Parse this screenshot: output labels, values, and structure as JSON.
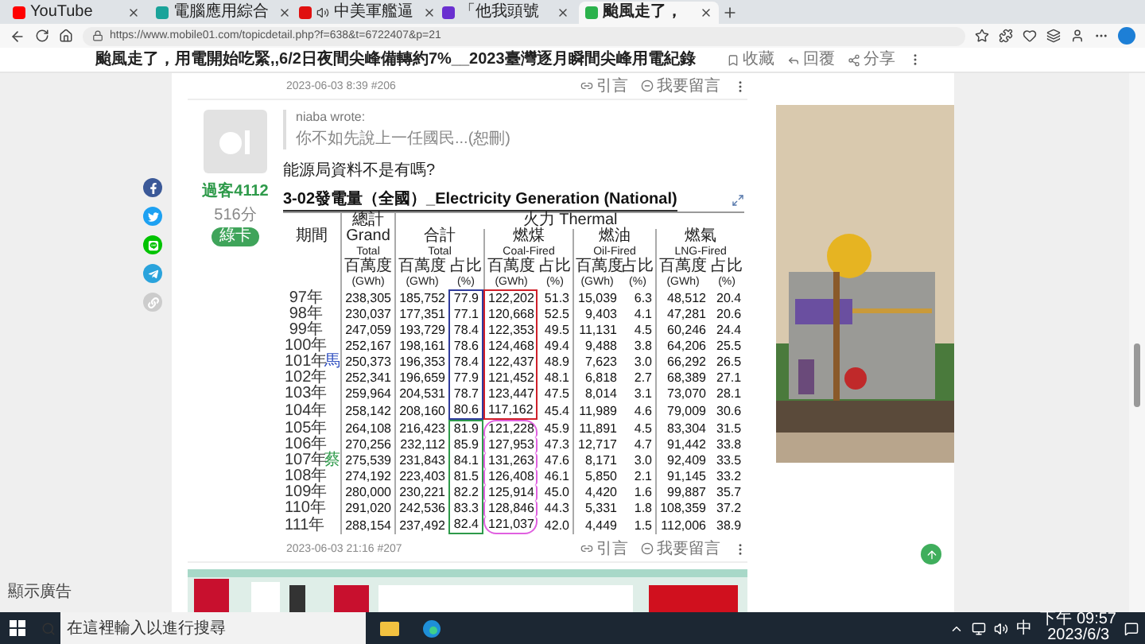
{
  "browser": {
    "tabs": [
      {
        "title": "YouTube",
        "color": "#ff0000",
        "audio": false,
        "selected": false
      },
      {
        "title": "電腦應用綜合",
        "color": "#1aa39a",
        "audio": false,
        "selected": false
      },
      {
        "title": "中美軍艦逼",
        "color": "#e01010",
        "audio": true,
        "selected": false
      },
      {
        "title": "「他我頭號",
        "color": "#6a2fd0",
        "audio": false,
        "selected": false
      },
      {
        "title": "颱風走了，",
        "color": "#2bb24c",
        "audio": false,
        "selected": true
      }
    ],
    "url": "https://www.mobile01.com/topicdetail.php?f=638&t=6722407&p=21"
  },
  "page": {
    "title": "颱風走了，用電開始吃緊,,6/2日夜間尖峰備轉約7%__2023臺灣逐月瞬間尖峰用電紀錄",
    "actions": [
      {
        "kind": "bookmark",
        "label": "收藏"
      },
      {
        "kind": "reply",
        "label": "回覆"
      },
      {
        "kind": "share",
        "label": "分享"
      }
    ]
  },
  "share_buttons": [
    {
      "kind": "facebook",
      "color": "#3b5998"
    },
    {
      "kind": "twitter",
      "color": "#1da1f2"
    },
    {
      "kind": "line",
      "color": "#00c300"
    },
    {
      "kind": "telegram",
      "color": "#2aa3dc"
    },
    {
      "kind": "link",
      "color": "#cccccc"
    }
  ],
  "ad_label": "顯示廣告",
  "previous_footer": {
    "meta": "2023-06-03 8:39 #206",
    "actions": [
      {
        "kind": "quote",
        "label": "引言"
      },
      {
        "kind": "comment",
        "label": "我要留言"
      }
    ]
  },
  "post": {
    "author": "過客4112",
    "score": "516分",
    "badge": "綠卡",
    "quote": {
      "author": "niaba wrote:",
      "text": "你不如先說上一任國民...(恕刪)"
    },
    "text": "能源局資料不是有嗎?",
    "table": {
      "title": "3-02發電量（全國）_Electricity Generation (National)",
      "period_header": "期間",
      "grand_header": [
        "總計",
        "Grand",
        "Total"
      ],
      "thermal_header": "火力 Thermal",
      "groups": [
        {
          "zh": "合計",
          "en": "Total"
        },
        {
          "zh": "燃煤",
          "en": "Coal-Fired"
        },
        {
          "zh": "燃油",
          "en": "Oil-Fired"
        },
        {
          "zh": "燃氣",
          "en": "LNG-Fired"
        }
      ],
      "unit_row": [
        "百萬度",
        "百萬度",
        "占比",
        "百萬度",
        "占比",
        "百萬度",
        "占比",
        "百萬度",
        "占比"
      ],
      "unit_row_en": [
        "(GWh)",
        "(GWh)",
        "(%)",
        "(GWh)",
        "(%)",
        "(GWh)",
        "(%)",
        "(GWh)",
        "(%)"
      ],
      "rows": [
        {
          "year": "97年",
          "values": [
            "238,305",
            "185,752",
            "77.9",
            "122,202",
            "51.3",
            "15,039",
            "6.3",
            "48,512",
            "20.4"
          ],
          "total_share_mark": {
            "color": "#2f3b9c",
            "kind": "box"
          },
          "coal_mark": {
            "color": "#d0202a",
            "kind": "box"
          }
        },
        {
          "year": "98年",
          "values": [
            "230,037",
            "177,351",
            "77.1",
            "120,668",
            "52.5",
            "9,403",
            "4.1",
            "47,281",
            "20.6"
          ],
          "total_share_mark": {
            "color": "#2f3b9c",
            "kind": "box"
          },
          "coal_mark": {
            "color": "#d0202a",
            "kind": "box"
          }
        },
        {
          "year": "99年",
          "values": [
            "247,059",
            "193,729",
            "78.4",
            "122,353",
            "49.5",
            "11,131",
            "4.5",
            "60,246",
            "24.4"
          ],
          "total_share_mark": {
            "color": "#2f3b9c",
            "kind": "box"
          },
          "coal_mark": {
            "color": "#d0202a",
            "kind": "box"
          }
        },
        {
          "year": "100年",
          "values": [
            "252,167",
            "198,161",
            "78.6",
            "124,468",
            "49.4",
            "9,488",
            "3.8",
            "64,206",
            "25.5"
          ],
          "total_share_mark": {
            "color": "#2f3b9c",
            "kind": "box"
          },
          "coal_mark": {
            "color": "#d0202a",
            "kind": "box"
          }
        },
        {
          "year": "101年",
          "tag": {
            "text": "馬",
            "color": "#3050c0"
          },
          "values": [
            "250,373",
            "196,353",
            "78.4",
            "122,437",
            "48.9",
            "7,623",
            "3.0",
            "66,292",
            "26.5"
          ],
          "total_share_mark": {
            "color": "#2f3b9c",
            "kind": "box"
          },
          "coal_mark": {
            "color": "#d0202a",
            "kind": "box"
          }
        },
        {
          "year": "102年",
          "values": [
            "252,341",
            "196,659",
            "77.9",
            "121,452",
            "48.1",
            "6,818",
            "2.7",
            "68,389",
            "27.1"
          ],
          "total_share_mark": {
            "color": "#2f3b9c",
            "kind": "box"
          },
          "coal_mark": {
            "color": "#d0202a",
            "kind": "box"
          }
        },
        {
          "year": "103年",
          "values": [
            "259,964",
            "204,531",
            "78.7",
            "123,447",
            "47.5",
            "8,014",
            "3.1",
            "73,070",
            "28.1"
          ],
          "total_share_mark": {
            "color": "#2f3b9c",
            "kind": "box"
          },
          "coal_mark": {
            "color": "#d0202a",
            "kind": "box"
          }
        },
        {
          "year": "104年",
          "values": [
            "258,142",
            "208,160",
            "80.6",
            "117,162",
            "45.4",
            "11,989",
            "4.6",
            "79,009",
            "30.6"
          ],
          "total_share_mark": {
            "color": "#2f3b9c",
            "kind": "box"
          },
          "coal_mark": {
            "color": "#d0202a",
            "kind": "box"
          }
        },
        {
          "year": "105年",
          "values": [
            "264,108",
            "216,423",
            "81.9",
            "121,228",
            "45.9",
            "11,891",
            "4.5",
            "83,304",
            "31.5"
          ],
          "total_share_mark": {
            "color": "#2e9a4a",
            "kind": "box"
          },
          "coal_mark": {
            "color": "#e060e0",
            "kind": "oval"
          }
        },
        {
          "year": "106年",
          "values": [
            "270,256",
            "232,112",
            "85.9",
            "127,953",
            "47.3",
            "12,717",
            "4.7",
            "91,442",
            "33.8"
          ],
          "total_share_mark": {
            "color": "#2e9a4a",
            "kind": "box"
          },
          "coal_mark": {
            "color": "#e060e0",
            "kind": "oval"
          }
        },
        {
          "year": "107年",
          "tag": {
            "text": "蔡",
            "color": "#2e9a4a"
          },
          "values": [
            "275,539",
            "231,843",
            "84.1",
            "131,263",
            "47.6",
            "8,171",
            "3.0",
            "92,409",
            "33.5"
          ],
          "total_share_mark": {
            "color": "#2e9a4a",
            "kind": "box"
          },
          "coal_mark": {
            "color": "#e060e0",
            "kind": "oval"
          }
        },
        {
          "year": "108年",
          "values": [
            "274,192",
            "223,403",
            "81.5",
            "126,408",
            "46.1",
            "5,850",
            "2.1",
            "91,145",
            "33.2"
          ],
          "total_share_mark": {
            "color": "#2e9a4a",
            "kind": "box"
          },
          "coal_mark": {
            "color": "#e060e0",
            "kind": "oval"
          }
        },
        {
          "year": "109年",
          "values": [
            "280,000",
            "230,221",
            "82.2",
            "125,914",
            "45.0",
            "4,420",
            "1.6",
            "99,887",
            "35.7"
          ],
          "total_share_mark": {
            "color": "#2e9a4a",
            "kind": "box"
          },
          "coal_mark": {
            "color": "#e060e0",
            "kind": "oval"
          }
        },
        {
          "year": "110年",
          "values": [
            "291,020",
            "242,536",
            "83.3",
            "128,846",
            "44.3",
            "5,331",
            "1.8",
            "108,359",
            "37.2"
          ],
          "total_share_mark": {
            "color": "#2e9a4a",
            "kind": "box"
          },
          "coal_mark": {
            "color": "#e060e0",
            "kind": "oval"
          }
        },
        {
          "year": "111年",
          "values": [
            "288,154",
            "237,492",
            "82.4",
            "121,037",
            "42.0",
            "4,449",
            "1.5",
            "112,006",
            "38.9"
          ],
          "total_share_mark": {
            "color": "#2e9a4a",
            "kind": "box"
          },
          "coal_mark": {
            "color": "#e060e0",
            "kind": "oval"
          }
        }
      ]
    },
    "footer": {
      "meta": "2023-06-03 21:16 #207",
      "actions": [
        {
          "kind": "quote",
          "label": "引言"
        },
        {
          "kind": "comment",
          "label": "我要留言"
        }
      ]
    }
  },
  "taskbar": {
    "search_placeholder": "在這裡輸入以進行搜尋",
    "ime": "中",
    "time": "下午 09:57",
    "date": "2023/6/3"
  }
}
